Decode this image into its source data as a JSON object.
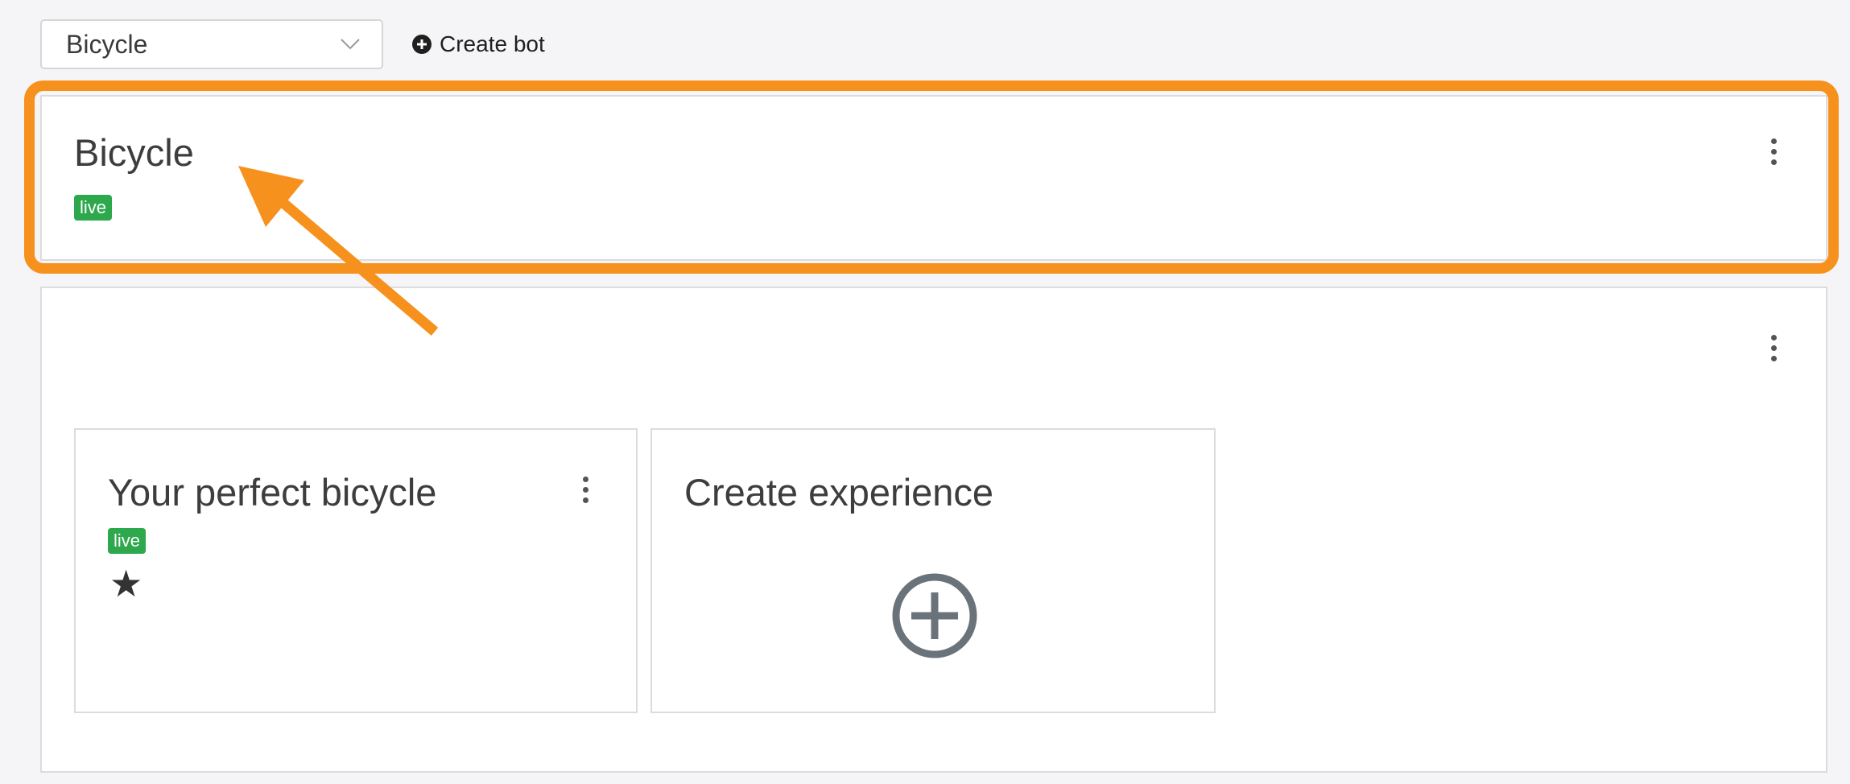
{
  "topbar": {
    "bot_select_value": "Bicycle",
    "create_bot_label": "Create bot"
  },
  "bot_card": {
    "title": "Bicycle",
    "status": "live"
  },
  "experiences": [
    {
      "title": "Your perfect bicycle",
      "status": "live",
      "star": "★"
    }
  ],
  "create_experience": {
    "title": "Create experience"
  },
  "icons": {
    "select_chevron": "chevron-down-icon",
    "create_bot": "plus-circle-icon",
    "menu": "kebab-menu-icon",
    "favorite": "star-icon",
    "add": "add-circle-icon"
  },
  "colors": {
    "live_badge": "#2ea84d",
    "annotation": "#f7911e"
  }
}
